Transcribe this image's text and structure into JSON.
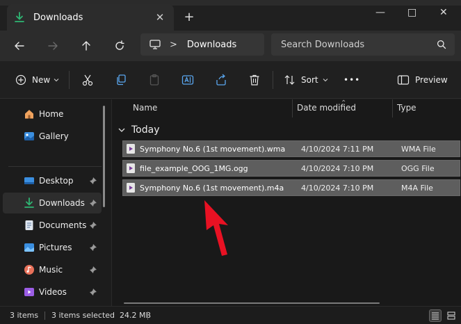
{
  "window": {
    "tab_title": "Downloads",
    "tab_close_glyph": "✕",
    "new_tab_glyph": "+",
    "minimize_glyph": "—",
    "maximize_glyph": "□",
    "close_glyph": "✕"
  },
  "navigation": {
    "breadcrumb_separator": ">",
    "breadcrumb_location": "Downloads",
    "search_placeholder": "Search Downloads"
  },
  "toolbar": {
    "new_label": "New",
    "sort_label": "Sort",
    "more_glyph": "•••",
    "preview_label": "Preview"
  },
  "sidebar": {
    "items": [
      {
        "label": "Home",
        "icon": "home-icon"
      },
      {
        "label": "Gallery",
        "icon": "gallery-icon"
      },
      {
        "label": "Desktop",
        "icon": "desktop-icon",
        "pinned": true
      },
      {
        "label": "Downloads",
        "icon": "download-icon",
        "pinned": true,
        "selected": true
      },
      {
        "label": "Documents",
        "icon": "documents-icon",
        "pinned": true
      },
      {
        "label": "Pictures",
        "icon": "pictures-icon",
        "pinned": true
      },
      {
        "label": "Music",
        "icon": "music-icon",
        "pinned": true
      },
      {
        "label": "Videos",
        "icon": "videos-icon",
        "pinned": true
      }
    ]
  },
  "file_list": {
    "columns": [
      "Name",
      "Date modified",
      "Type"
    ],
    "group_label": "Today",
    "rows": [
      {
        "name": "Symphony No.6 (1st movement).wma",
        "date": "4/10/2024 7:11 PM",
        "type": "WMA File"
      },
      {
        "name": "file_example_OOG_1MG.ogg",
        "date": "4/10/2024 7:10 PM",
        "type": "OGG File"
      },
      {
        "name": "Symphony No.6 (1st movement).m4a",
        "date": "4/10/2024 7:10 PM",
        "type": "M4A File"
      }
    ]
  },
  "status": {
    "item_count": "3 items",
    "selection": "3 items selected  24.2 MB"
  },
  "colors": {
    "accent_download": "#2fb673",
    "annotation_arrow": "#e81123",
    "selection_row": "#5e5e5e"
  }
}
